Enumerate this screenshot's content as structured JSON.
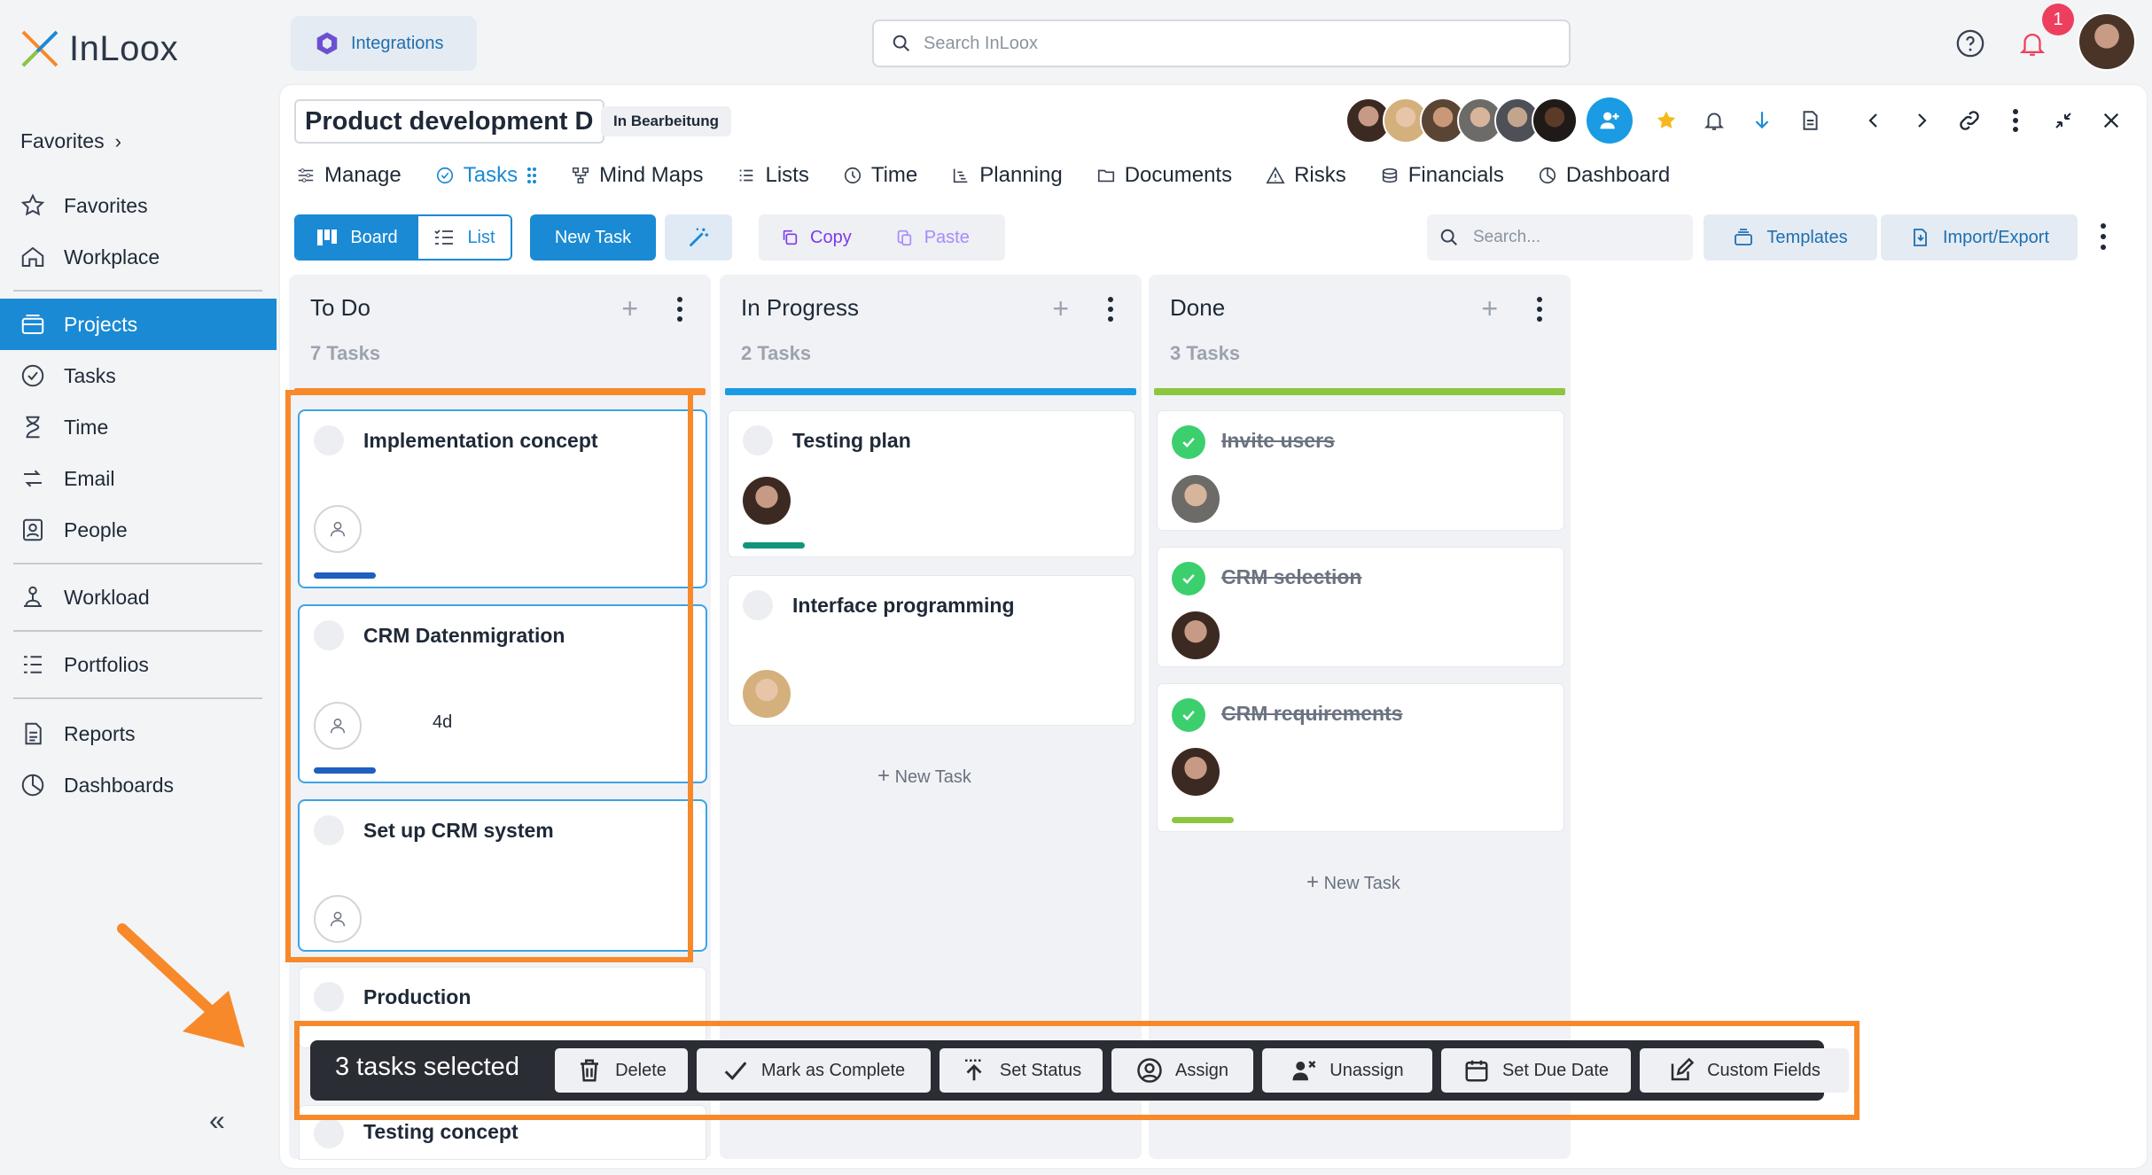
{
  "app": {
    "name": "InLoox"
  },
  "sidebar": {
    "favorites_header": "Favorites",
    "items": [
      {
        "label": "Favorites",
        "icon": "star-icon"
      },
      {
        "label": "Workplace",
        "icon": "home-icon"
      },
      {
        "label": "Projects",
        "icon": "projects-icon",
        "active": true
      },
      {
        "label": "Tasks",
        "icon": "check-circle-icon"
      },
      {
        "label": "Time",
        "icon": "hourglass-icon"
      },
      {
        "label": "Email",
        "icon": "email-sync-icon"
      },
      {
        "label": "People",
        "icon": "contact-card-icon"
      },
      {
        "label": "Workload",
        "icon": "workload-icon"
      },
      {
        "label": "Portfolios",
        "icon": "portfolio-icon"
      },
      {
        "label": "Reports",
        "icon": "report-icon"
      },
      {
        "label": "Dashboards",
        "icon": "pie-chart-icon"
      }
    ],
    "collapse_label": "«"
  },
  "topbar": {
    "integrations_label": "Integrations",
    "search_placeholder": "Search InLoox",
    "notification_count": "1"
  },
  "project": {
    "title": "Product development D",
    "status": "In Bearbeitung"
  },
  "tabs": [
    {
      "label": "Manage"
    },
    {
      "label": "Tasks",
      "active": true
    },
    {
      "label": "Mind Maps"
    },
    {
      "label": "Lists"
    },
    {
      "label": "Time"
    },
    {
      "label": "Planning"
    },
    {
      "label": "Documents"
    },
    {
      "label": "Risks"
    },
    {
      "label": "Financials"
    },
    {
      "label": "Dashboard"
    }
  ],
  "toolbar": {
    "board_label": "Board",
    "list_label": "List",
    "new_task_label": "New Task",
    "copy_label": "Copy",
    "paste_label": "Paste",
    "search_placeholder": "Search...",
    "templates_label": "Templates",
    "import_export_label": "Import/Export"
  },
  "columns": [
    {
      "title": "To Do",
      "count": "7 Tasks",
      "bar_color": "#f7892a",
      "cards": [
        {
          "title": "Implementation concept",
          "progress_color": "#1e5fbf"
        },
        {
          "title": "CRM Datenmigration",
          "duration": "4d",
          "progress_color": "#1e5fbf"
        },
        {
          "title": "Set up CRM system"
        },
        {
          "title": "Production"
        },
        {
          "title": "Testing concept"
        }
      ]
    },
    {
      "title": "In Progress",
      "count": "2 Tasks",
      "bar_color": "#1a9be3",
      "cards": [
        {
          "title": "Testing plan",
          "progress_color": "#12957a"
        },
        {
          "title": "Interface programming"
        }
      ],
      "new_task_label": "New Task"
    },
    {
      "title": "Done",
      "count": "3 Tasks",
      "bar_color": "#8cc63f",
      "cards": [
        {
          "title": "Invite users"
        },
        {
          "title": "CRM selection"
        },
        {
          "title": "CRM requirements",
          "progress_color": "#8cc63f"
        }
      ],
      "new_task_label": "New Task"
    }
  ],
  "action_bar": {
    "selected_text": "3 tasks selected",
    "buttons": [
      {
        "label": "Delete",
        "icon": "trash-icon"
      },
      {
        "label": "Mark as Complete",
        "icon": "checkmark-icon"
      },
      {
        "label": "Set Status",
        "icon": "status-arrow-icon"
      },
      {
        "label": "Assign",
        "icon": "user-circle-icon"
      },
      {
        "label": "Unassign",
        "icon": "user-remove-icon"
      },
      {
        "label": "Set Due Date",
        "icon": "calendar-icon"
      },
      {
        "label": "Custom Fields",
        "icon": "edit-icon"
      }
    ]
  },
  "colors": {
    "accent": "#1a8ad4",
    "highlight": "#f7892a",
    "done_green": "#3ccf6d"
  }
}
